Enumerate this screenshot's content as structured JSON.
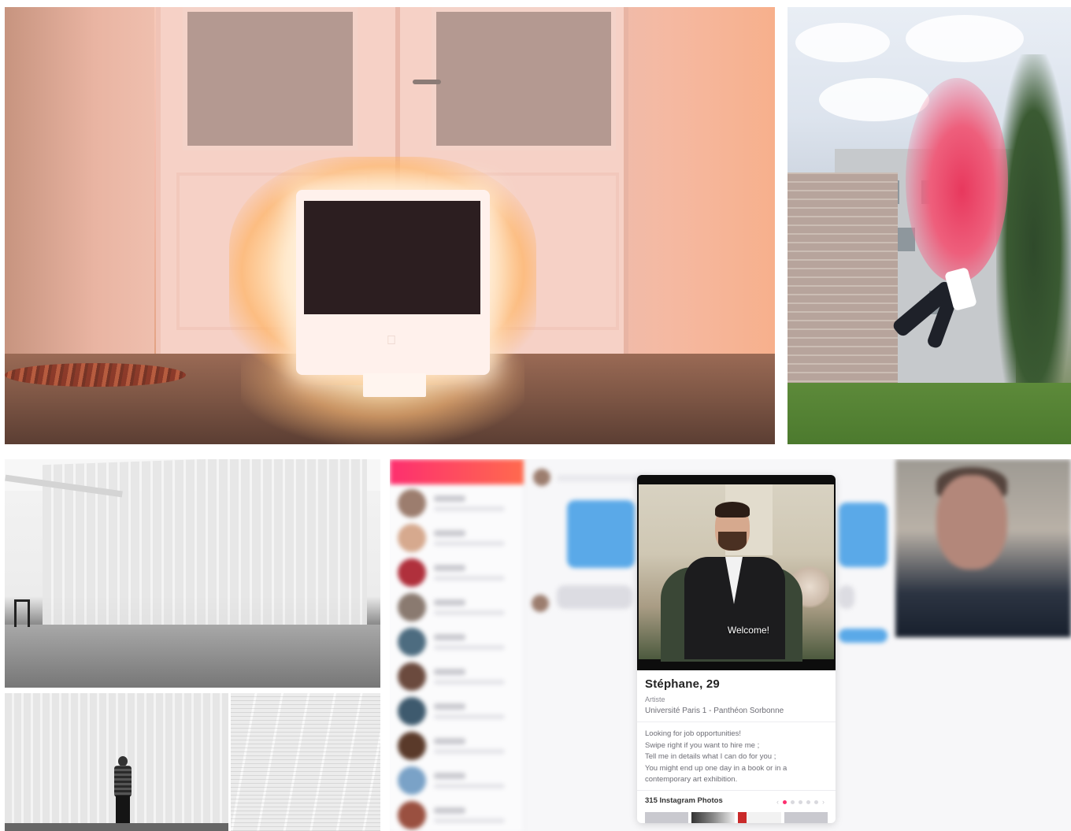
{
  "profile_card": {
    "overlay_text": "Welcome!",
    "name_age": "Stéphane, 29",
    "job": "Artiste",
    "school": "Université Paris 1 - Panthéon Sorbonne",
    "bio_lines": [
      "Looking for job opportunities!",
      "Swipe right if you want to hire me ;",
      "Tell me in details what I can do for you ;",
      "You might end up one day in a book or in a",
      "contemporary art exhibition."
    ],
    "instagram_label": "315 Instagram Photos"
  },
  "colors": {
    "brand_gradient_start": "#fd2f6f",
    "brand_gradient_end": "#ff6a4e",
    "chat_bubble": "#5aa9e8"
  }
}
